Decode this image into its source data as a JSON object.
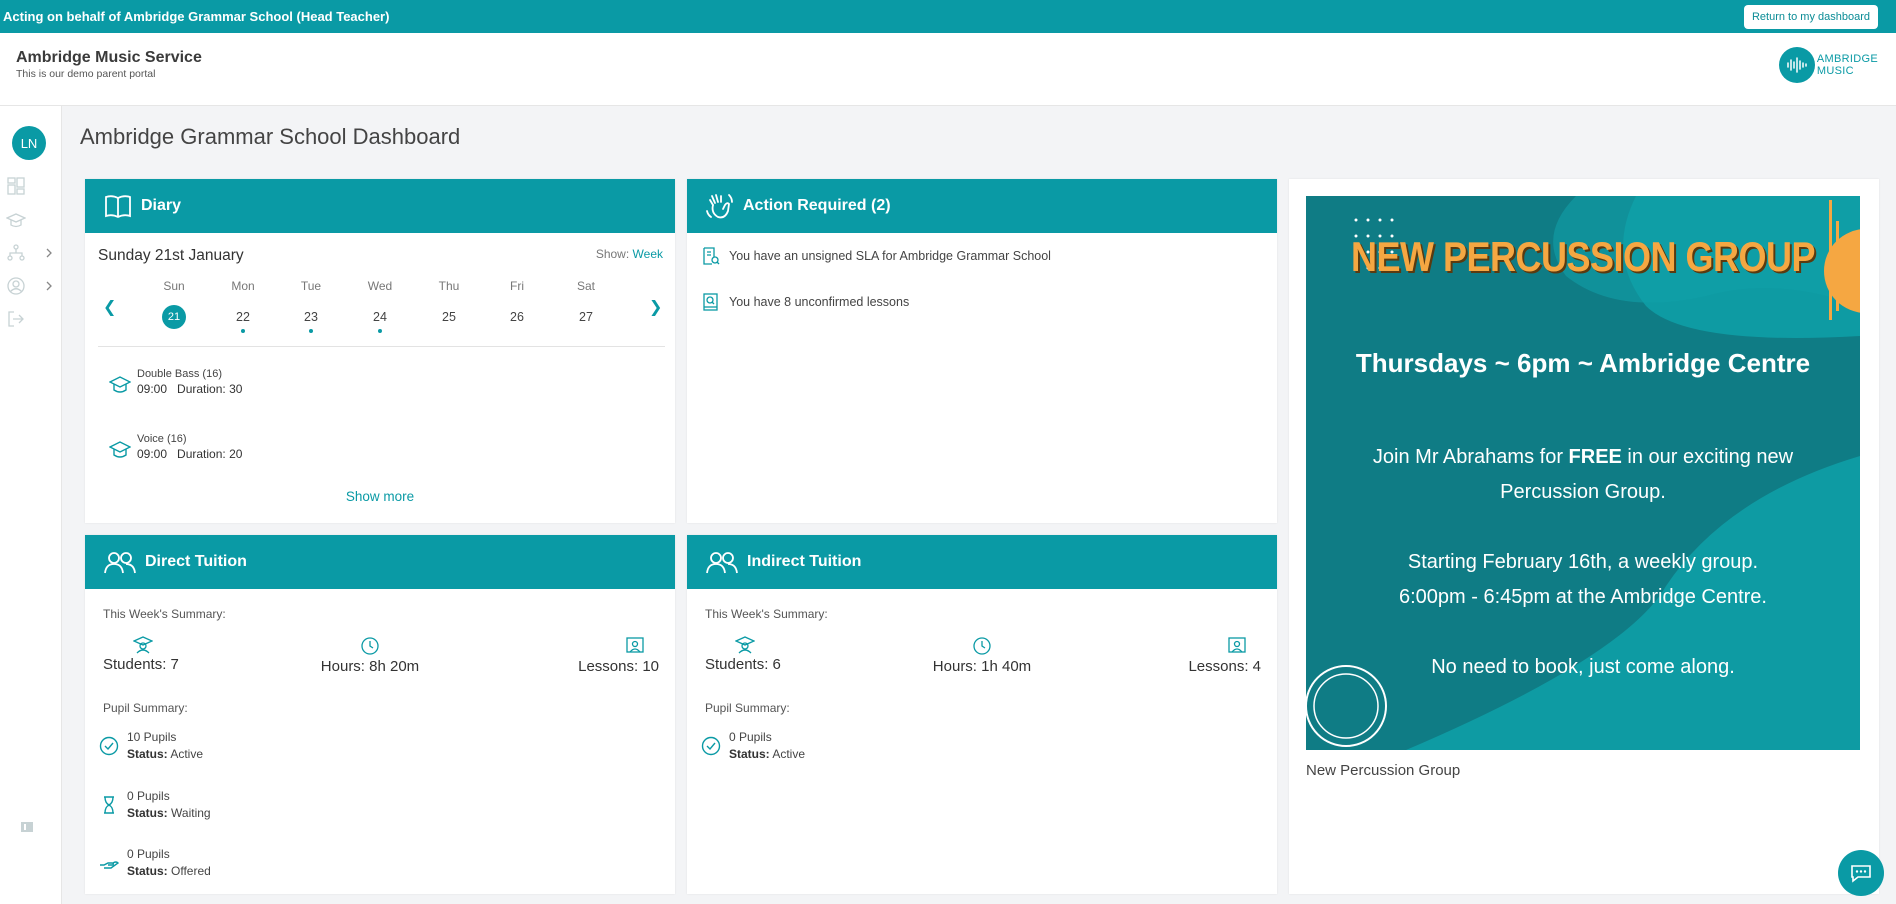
{
  "topbar": {
    "acting_text": "Acting on behalf of Ambridge Grammar School (Head Teacher)",
    "return_label": "Return to my dashboard"
  },
  "header": {
    "title": "Ambridge Music Service",
    "subtitle": "This is our demo parent portal",
    "logo_line1": "AMBRIDGE",
    "logo_line2": "MUSIC"
  },
  "sidebar": {
    "avatar_initials": "LN",
    "icons": [
      "dashboard-icon",
      "graduation-cap-icon",
      "org-chart-icon",
      "user-circle-icon",
      "logout-icon",
      "info-icon"
    ]
  },
  "page": {
    "title": "Ambridge Grammar School Dashboard"
  },
  "diary": {
    "title": "Diary",
    "date": "Sunday 21st January",
    "show_label": "Show:",
    "show_value": "Week",
    "days": [
      {
        "name": "Sun",
        "date": "21",
        "selected": true,
        "dot": false
      },
      {
        "name": "Mon",
        "date": "22",
        "selected": false,
        "dot": true
      },
      {
        "name": "Tue",
        "date": "23",
        "selected": false,
        "dot": true
      },
      {
        "name": "Wed",
        "date": "24",
        "selected": false,
        "dot": true
      },
      {
        "name": "Thu",
        "date": "25",
        "selected": false,
        "dot": false
      },
      {
        "name": "Fri",
        "date": "26",
        "selected": false,
        "dot": false
      },
      {
        "name": "Sat",
        "date": "27",
        "selected": false,
        "dot": false
      }
    ],
    "lessons": [
      {
        "name": "Double Bass (16)",
        "time": "09:00",
        "duration": "Duration: 30"
      },
      {
        "name": "Voice (16)",
        "time": "09:00",
        "duration": "Duration: 20"
      }
    ],
    "show_more": "Show more"
  },
  "action_required": {
    "title": "Action Required (2)",
    "items": [
      "You have an unsigned SLA for Ambridge Grammar School",
      "You have 8 unconfirmed lessons"
    ]
  },
  "direct_tuition": {
    "title": "Direct Tuition",
    "week_summary_label": "This Week's Summary:",
    "students": "Students: 7",
    "hours": "Hours: 8h 20m",
    "lessons": "Lessons: 10",
    "pupil_summary_label": "Pupil Summary:",
    "pupils": [
      {
        "count": "10 Pupils",
        "status_label": "Status:",
        "status": "Active"
      },
      {
        "count": "0 Pupils",
        "status_label": "Status:",
        "status": "Waiting"
      },
      {
        "count": "0 Pupils",
        "status_label": "Status:",
        "status": "Offered"
      }
    ]
  },
  "indirect_tuition": {
    "title": "Indirect Tuition",
    "week_summary_label": "This Week's Summary:",
    "students": "Students: 6",
    "hours": "Hours: 1h 40m",
    "lessons": "Lessons: 4",
    "pupil_summary_label": "Pupil Summary:",
    "pupils": [
      {
        "count": "0 Pupils",
        "status_label": "Status:",
        "status": "Active"
      }
    ]
  },
  "promo": {
    "title": "NEW PERCUSSION GROUP",
    "subtitle": "Thursdays ~ 6pm ~ Ambridge Centre",
    "line1_pre": "Join Mr Abrahams for ",
    "line1_bold": "FREE",
    "line1_post": " in our exciting new Percussion Group.",
    "line2": "Starting February 16th, a weekly group.",
    "line3": "6:00pm - 6:45pm at the Ambridge Centre.",
    "line4": "No need to book, just come along.",
    "caption": "New Percussion Group"
  },
  "colors": {
    "accent": "#0a9aa5",
    "promo_orange": "#f5a742"
  }
}
